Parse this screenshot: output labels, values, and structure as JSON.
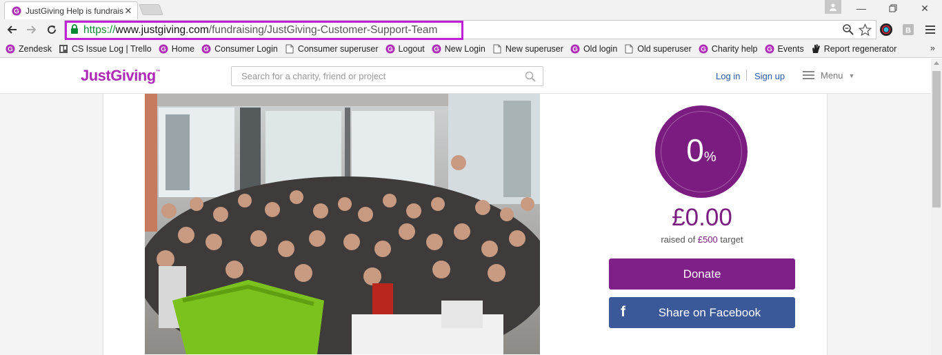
{
  "browser": {
    "tab_title": "JustGiving Help is fundrais",
    "tab_close": "✕",
    "url_scheme": "https://",
    "url_domain": "www.justgiving.com",
    "url_path": "/fundraising/JustGiving-Customer-Support-Team",
    "bookmarks": [
      {
        "label": "Zendesk",
        "icon": "justgiving-icon"
      },
      {
        "label": "CS Issue Log | Trello",
        "icon": "trello-icon"
      },
      {
        "label": "Home",
        "icon": "justgiving-icon"
      },
      {
        "label": "Consumer Login",
        "icon": "justgiving-icon"
      },
      {
        "label": "Consumer superuser",
        "icon": "page-icon"
      },
      {
        "label": "Logout",
        "icon": "justgiving-icon"
      },
      {
        "label": "New Login",
        "icon": "justgiving-icon"
      },
      {
        "label": "New superuser",
        "icon": "page-icon"
      },
      {
        "label": "Old login",
        "icon": "justgiving-icon"
      },
      {
        "label": "Old superuser",
        "icon": "page-icon"
      },
      {
        "label": "Charity help",
        "icon": "justgiving-icon"
      },
      {
        "label": "Events",
        "icon": "justgiving-icon"
      },
      {
        "label": "Report regenerator",
        "icon": "hand-icon"
      }
    ],
    "bookmarks_more": "»"
  },
  "header": {
    "logo": "JustGiving",
    "logo_tm": "™",
    "search_placeholder": "Search for a charity, friend or project",
    "login": "Log in",
    "signup": "Sign up",
    "menu": "Menu"
  },
  "fundraising": {
    "percent": "0",
    "percent_symbol": "%",
    "progress_fraction": 0.0,
    "amount": "£0.00",
    "raised_prefix": "raised of",
    "target": "£500",
    "raised_suffix": "target",
    "donate_label": "Donate",
    "facebook_label": "Share on Facebook",
    "facebook_glyph": "f"
  },
  "colors": {
    "brand_purple": "#7a1c80",
    "logo_purple": "#ad29b6",
    "facebook_blue": "#3b5998",
    "link_blue": "#2a5aa8",
    "url_highlight": "#c021d8"
  }
}
